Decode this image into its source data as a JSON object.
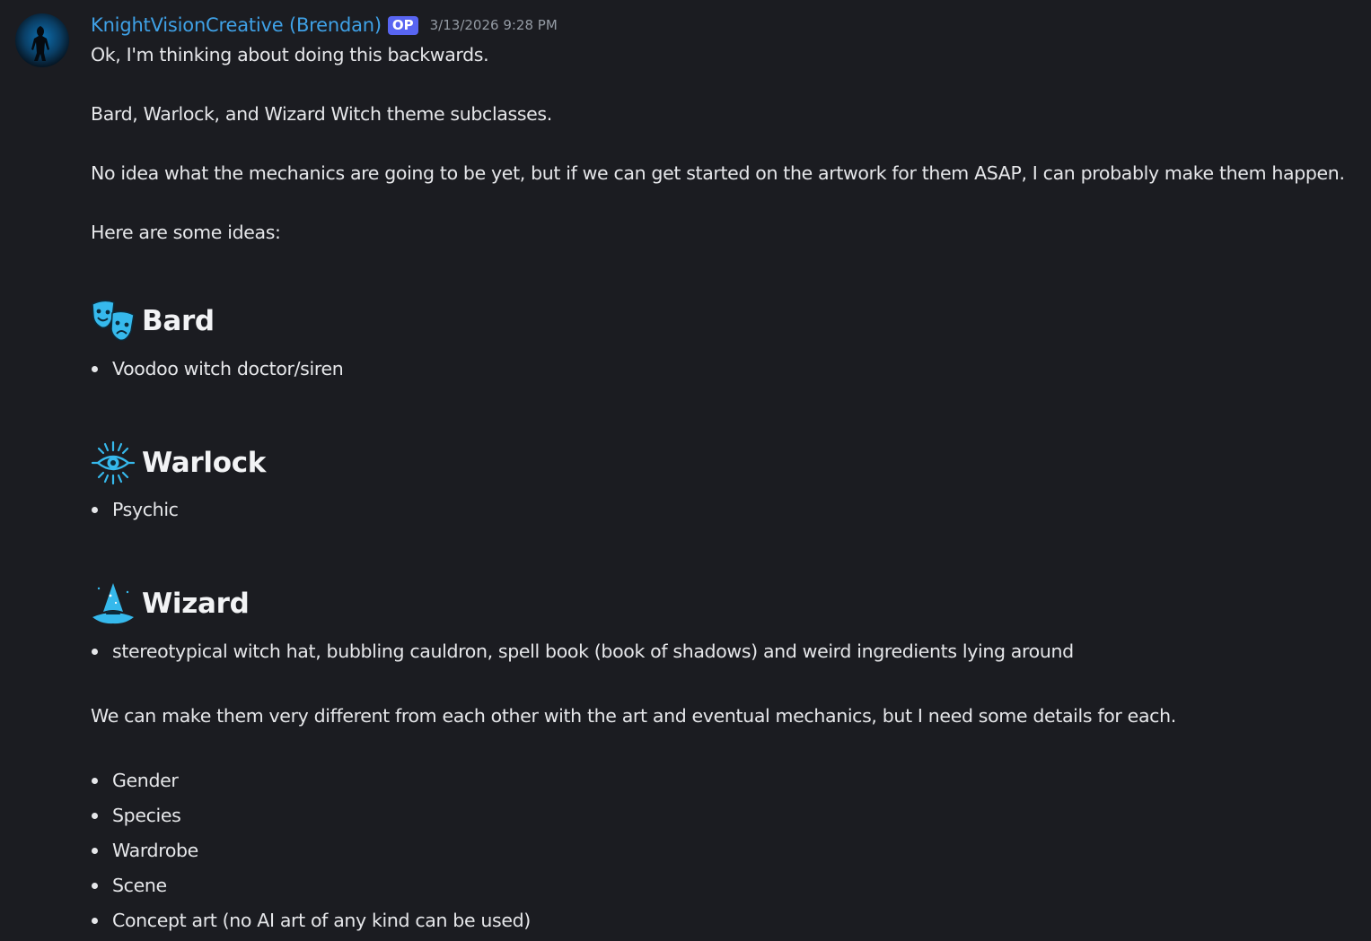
{
  "author": {
    "name": "KnightVisionCreative (Brendan)",
    "badge": "OP",
    "timestamp": "3/13/2026 9:28 PM"
  },
  "message": {
    "intro": "Ok, I'm thinking about doing this backwards.",
    "themes": "Bard, Warlock, and Wizard Witch theme subclasses.",
    "mechanics": "No idea what the mechanics are going to be yet, but if we can get started on the artwork for them ASAP, I can probably make them happen.",
    "ideas_lead": "Here are some ideas:",
    "sections": [
      {
        "icon": "theater-masks-icon",
        "title": "Bard",
        "bullets": [
          "Voodoo witch doctor/siren"
        ]
      },
      {
        "icon": "eye-sun-icon",
        "title": "Warlock",
        "bullets": [
          "Psychic"
        ]
      },
      {
        "icon": "wizard-hat-icon",
        "title": "Wizard",
        "bullets": [
          "stereotypical witch hat, bubbling cauldron, spell book (book of shadows) and weird ingredients lying around"
        ]
      }
    ],
    "details_lead": "We can make them very different from each other with the art and eventual mechanics, but I need some details for each.",
    "details": [
      "Gender",
      "Species",
      "Wardrobe",
      "Scene",
      "Concept art (no AI art of any kind can be used)"
    ]
  },
  "colors": {
    "background": "#1b1c21",
    "username": "#3fa1e6",
    "badge": "#5865f2",
    "icon": "#36b9ec"
  }
}
